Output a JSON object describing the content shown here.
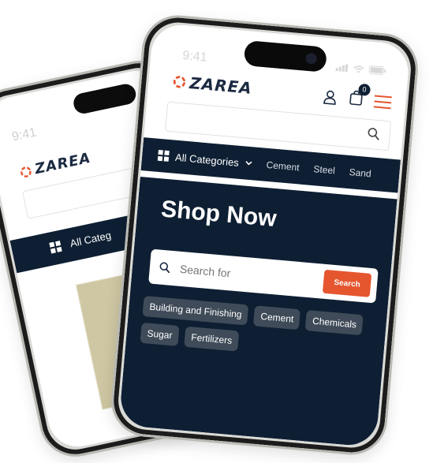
{
  "back_phone": {
    "time": "9:41",
    "brand": "ZAREA",
    "category_label": "All Categ"
  },
  "front_phone": {
    "time": "9:41",
    "brand": "ZAREA",
    "cart_count": "0",
    "nav": {
      "categories_label": "All Categories",
      "links": [
        "Cement",
        "Steel",
        "Sand"
      ]
    },
    "hero": {
      "title": "Shop Now",
      "search_placeholder": "Search for",
      "search_button": "Search",
      "chips": [
        "Building and Finishing",
        "Cement",
        "Chemicals",
        "Sugar",
        "Fertilizers"
      ]
    }
  },
  "colors": {
    "navy": "#0e1f33",
    "accent": "#e5562e",
    "chip": "#3f4b58"
  },
  "icons": [
    "logo-icon",
    "user-icon",
    "cart-icon",
    "menu-icon",
    "search-icon",
    "grid-icon",
    "chevron-down-icon",
    "signal-icon",
    "wifi-icon",
    "battery-icon"
  ]
}
